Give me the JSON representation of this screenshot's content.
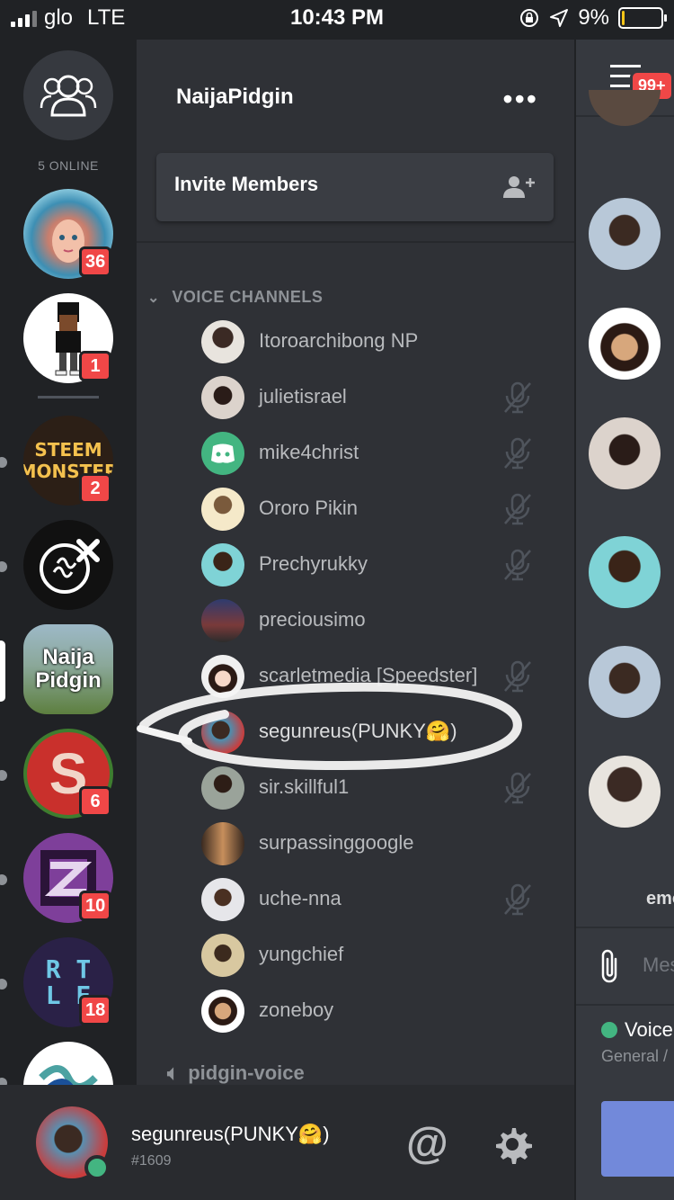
{
  "status_bar": {
    "carrier": "glo",
    "network": "LTE",
    "time": "10:43 PM",
    "battery": "9%",
    "battery_level": 0.09
  },
  "guild_sidebar": {
    "online_label": "5 ONLINE",
    "guilds": [
      {
        "name": "abstract-face-server",
        "badge": "36"
      },
      {
        "name": "cartoon-character-server",
        "badge": "1"
      },
      {
        "name": "steem-monster-server",
        "text": "STEEM MONSTER",
        "badge": "2"
      },
      {
        "name": "steem-x-server",
        "badge": ""
      },
      {
        "name": "naija-pidgin-server",
        "text": "Naija Pidgin",
        "badge": ""
      },
      {
        "name": "watermelon-s-server",
        "badge": "6"
      },
      {
        "name": "purple-z-server",
        "badge": "10"
      },
      {
        "name": "rtle-server",
        "text": "R T L E",
        "badge": "18"
      },
      {
        "name": "steemit-server",
        "badge": ""
      }
    ]
  },
  "channel_panel": {
    "server_name": "NaijaPidgin",
    "more_label": "•••",
    "invite_label": "Invite Members",
    "category_label": "VOICE CHANNELS",
    "members": [
      {
        "name": "Itoroarchibong NP",
        "muted": false
      },
      {
        "name": "julietisrael",
        "muted": true
      },
      {
        "name": "mike4christ",
        "muted": true
      },
      {
        "name": "Ororo Pikin",
        "muted": true
      },
      {
        "name": "Prechyrukky",
        "muted": true
      },
      {
        "name": "preciousimo",
        "muted": false
      },
      {
        "name": "scarletmedia [Speedster]",
        "muted": true
      },
      {
        "name": "segunreus(PUNKY🤗)",
        "muted": false
      },
      {
        "name": "sir.skillful1",
        "muted": true
      },
      {
        "name": "surpassinggoogle",
        "muted": false
      },
      {
        "name": "uche-nna",
        "muted": true
      },
      {
        "name": "yungchief",
        "muted": false
      },
      {
        "name": "zoneboy",
        "muted": false
      }
    ],
    "next_channel": "pidgin-voice"
  },
  "user_bar": {
    "username": "segunreus(PUNKY🤗)",
    "tag": "#1609",
    "mention_label": "@"
  },
  "chat_peek": {
    "badge": "99+",
    "partial_name": "emo",
    "input_placeholder": "Mes",
    "voice_label": "Voice",
    "voice_sub": "General /"
  },
  "colors": {
    "background": "#202225",
    "panel": "#2f3136",
    "chat": "#36393f",
    "badge_red": "#f04747",
    "online_green": "#43b581",
    "blurple": "#7289da"
  }
}
